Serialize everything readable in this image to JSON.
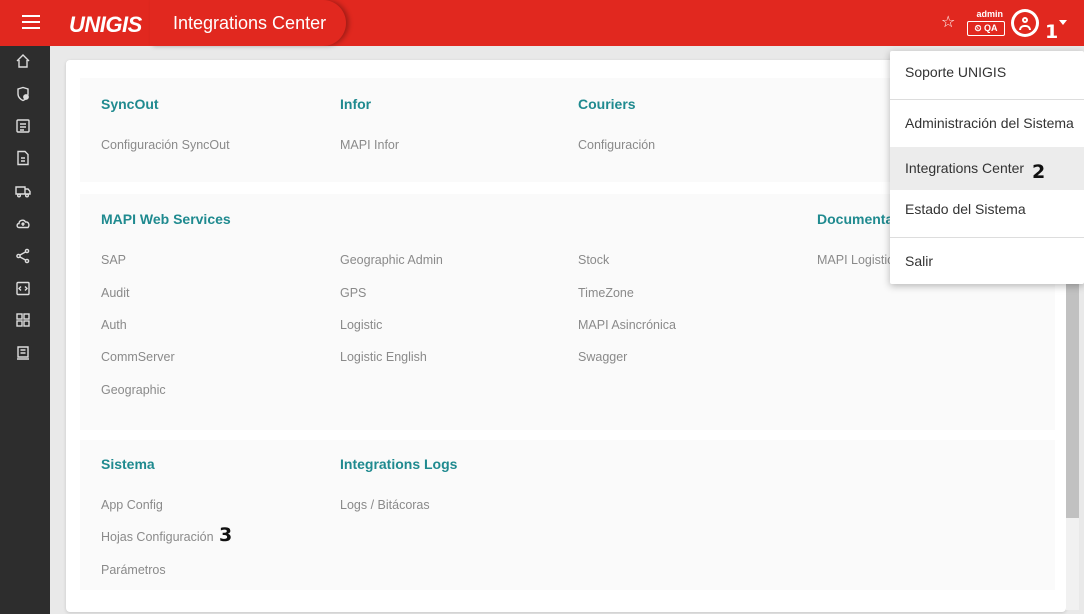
{
  "header": {
    "logo": "UNIGIS",
    "title": "Integrations Center",
    "admin_label": "admin",
    "env_badge": "⏲ QA",
    "menu_icon": "hamburger-icon",
    "star_icon": "star-icon",
    "avatar_icon": "account-circle-icon"
  },
  "annotations": {
    "step1": "1",
    "step2": "2",
    "step3": "3"
  },
  "sidebar": {
    "icons": [
      "home-icon",
      "shield-icon",
      "list-icon",
      "document-icon",
      "truck-icon",
      "cloud-upload-icon",
      "share-icon",
      "code-icon",
      "dashboard-icon",
      "receipt-icon"
    ]
  },
  "sections": {
    "syncout": {
      "title": "SyncOut",
      "items": [
        "Configuración SyncOut"
      ]
    },
    "infor": {
      "title": "Infor",
      "items": [
        "MAPI Infor"
      ]
    },
    "couriers": {
      "title": "Couriers",
      "items": [
        "Configuración"
      ]
    },
    "mapi_ws": {
      "title": "MAPI Web Services",
      "col1": [
        "SAP",
        "Audit",
        "Auth",
        "CommServer",
        "Geographic"
      ],
      "col2": [
        "Geographic Admin",
        "GPS",
        "Logistic",
        "Logistic English"
      ],
      "col3": [
        "Stock",
        "TimeZone",
        "MAPI Asincrónica",
        "Swagger"
      ]
    },
    "documentation": {
      "title": "Documenta",
      "items": [
        "MAPI Logistic"
      ]
    },
    "sistema": {
      "title": "Sistema",
      "items": [
        "App Config",
        "Hojas Configuración",
        "Parámetros"
      ]
    },
    "integrations_logs": {
      "title": "Integrations Logs",
      "items": [
        "Logs / Bitácoras"
      ]
    }
  },
  "dropdown": {
    "items": [
      "Soporte UNIGIS",
      "Administración del Sistema",
      "Integrations Center",
      "Estado del Sistema",
      "Salir"
    ],
    "active": "Integrations Center"
  },
  "colors": {
    "topbar": "#e1281f",
    "sidebar": "#2d2d2d",
    "section_title": "#1f8a8f"
  }
}
